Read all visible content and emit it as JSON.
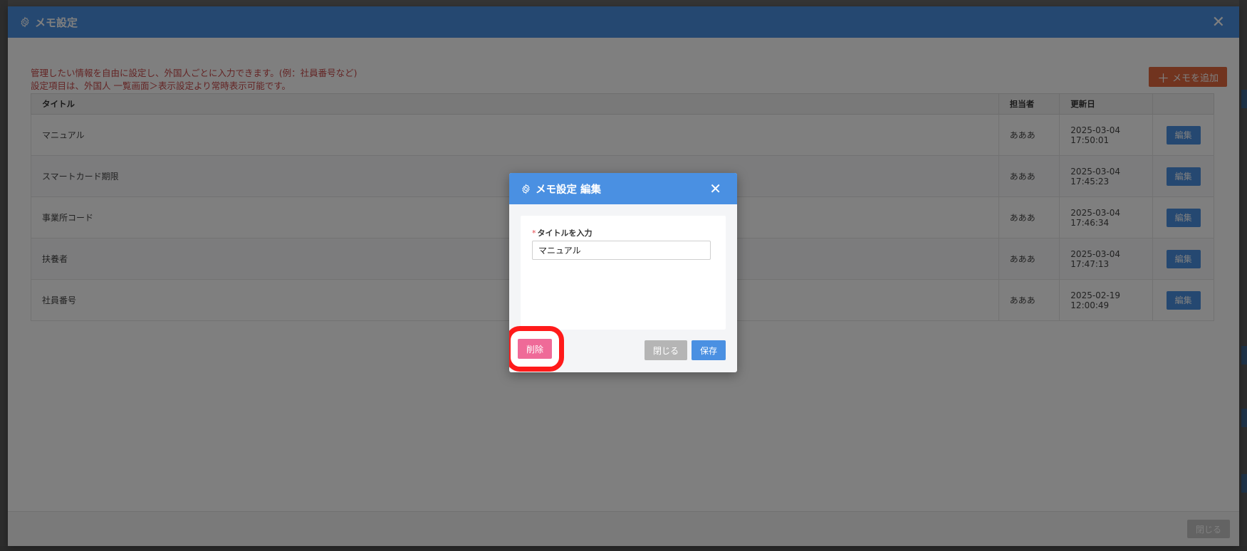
{
  "main_modal": {
    "title": "メモ設定",
    "notes": [
      "管理したい情報を自由に設定し、外国人ごとに入力できます。(例：社員番号など)",
      "設定項目は、外国人 一覧画面＞表示設定より常時表示可能です。"
    ],
    "add_button": "メモを追加",
    "table": {
      "headers": [
        "タイトル",
        "担当者",
        "更新日",
        ""
      ],
      "rows": [
        {
          "title": "マニュアル",
          "owner": "あああ",
          "updated": "2025-03-04 17:50:01",
          "action": "編集"
        },
        {
          "title": "スマートカード期限",
          "owner": "あああ",
          "updated": "2025-03-04 17:45:23",
          "action": "編集"
        },
        {
          "title": "事業所コード",
          "owner": "あああ",
          "updated": "2025-03-04 17:46:34",
          "action": "編集"
        },
        {
          "title": "扶養者",
          "owner": "あああ",
          "updated": "2025-03-04 17:47:13",
          "action": "編集"
        },
        {
          "title": "社員番号",
          "owner": "あああ",
          "updated": "2025-02-19 12:00:49",
          "action": "編集"
        }
      ]
    },
    "footer_close": "閉じる"
  },
  "edit_dialog": {
    "title": "メモ設定 編集",
    "required_mark": "*",
    "field_label": "タイトルを入力",
    "field_value": "マニュアル",
    "delete_button": "削除",
    "close_button": "閉じる",
    "save_button": "保存"
  },
  "colors": {
    "header_blue": "#4a90e2",
    "add_orange": "#e2693f",
    "delete_pink": "#ef6a98",
    "highlight_red": "#ff1a1a"
  }
}
